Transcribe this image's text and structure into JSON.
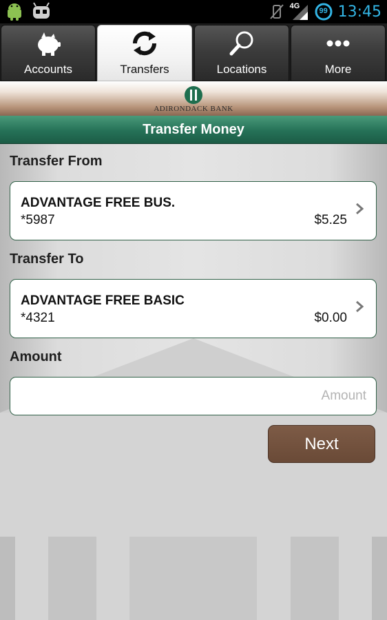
{
  "status_bar": {
    "time": "13:45",
    "network": "4G",
    "badge": "99"
  },
  "tabs": [
    {
      "label": "Accounts",
      "icon": "piggy-bank-icon"
    },
    {
      "label": "Transfers",
      "icon": "refresh-arrows-icon",
      "active": true
    },
    {
      "label": "Locations",
      "icon": "magnifier-icon"
    },
    {
      "label": "More",
      "icon": "more-dots-icon"
    }
  ],
  "brand": {
    "name": "ADIRONDACK BANK"
  },
  "screen": {
    "title": "Transfer Money"
  },
  "form": {
    "from_label": "Transfer From",
    "from_account": {
      "name": "ADVANTAGE FREE BUS.",
      "number": "*5987",
      "balance": "$5.25"
    },
    "to_label": "Transfer To",
    "to_account": {
      "name": "ADVANTAGE FREE BASIC",
      "number": "*4321",
      "balance": "$0.00"
    },
    "amount_label": "Amount",
    "amount_placeholder": "Amount",
    "amount_value": "",
    "next_label": "Next"
  },
  "colors": {
    "title_bar": "#257157",
    "button": "#7a5843",
    "status_accent": "#33b5e5",
    "card_border": "#2f5f46"
  }
}
